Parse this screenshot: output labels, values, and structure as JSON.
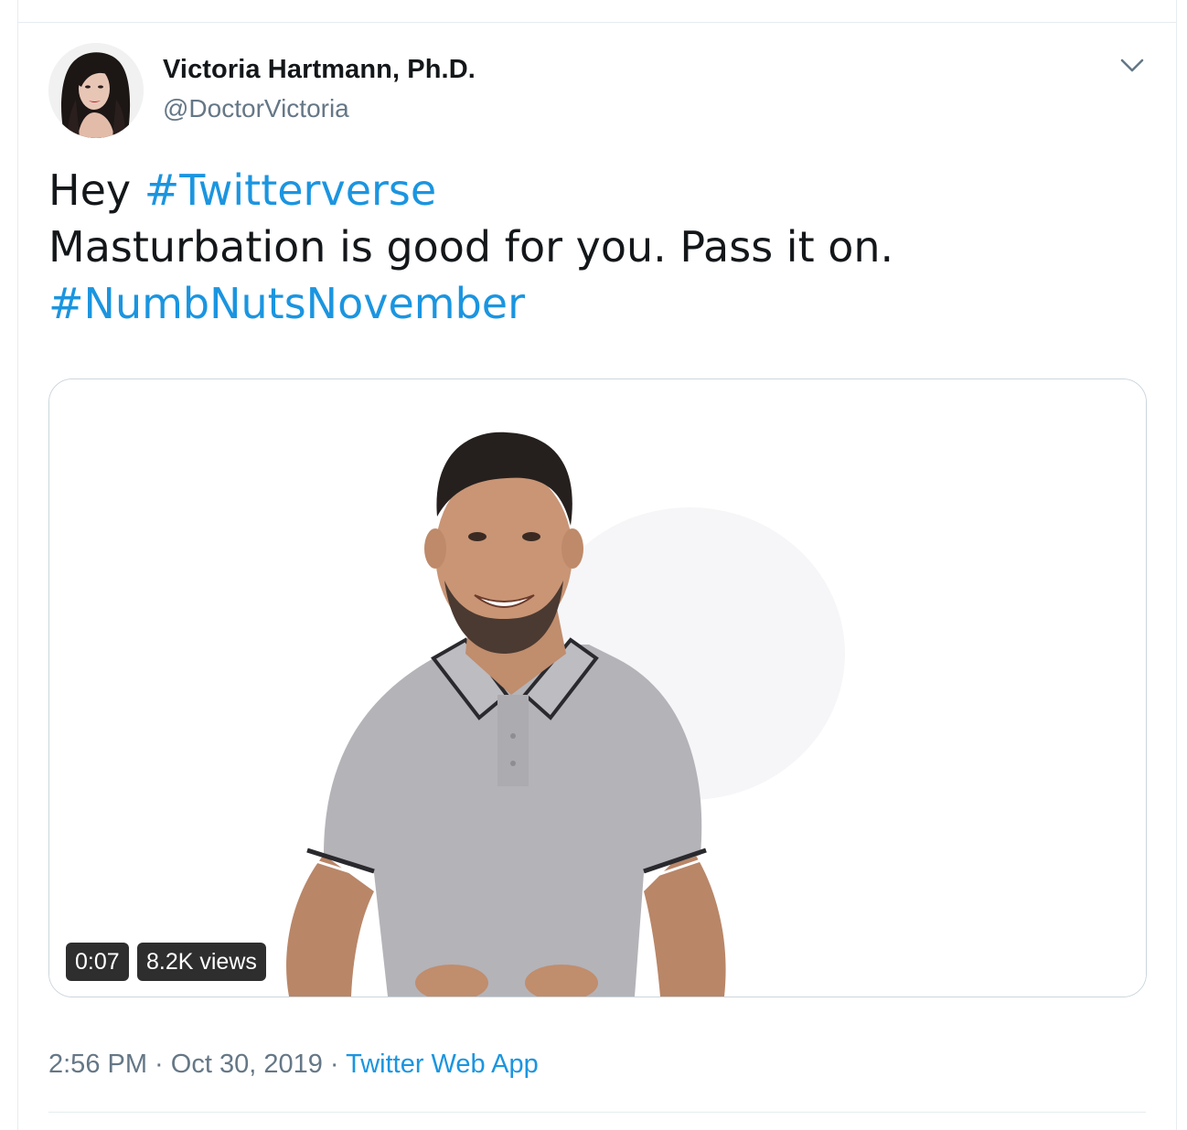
{
  "tweet": {
    "author": {
      "display_name": "Victoria Hartmann, Ph.D.",
      "handle": "@DoctorVictoria",
      "avatar_icon": "profile-photo"
    },
    "text": {
      "line1_prefix": "Hey ",
      "line1_hashtag": "#Twitterverse",
      "line2": "Masturbation is good for you. Pass it on.",
      "line3_hashtag": "#NumbNutsNovember"
    },
    "video": {
      "duration": "0:07",
      "views": "8.2K views"
    },
    "meta": {
      "time": "2:56 PM",
      "separator": " · ",
      "date": "Oct 30, 2019",
      "source": "Twitter Web App"
    }
  },
  "colors": {
    "link": "#1b95e0",
    "text": "#14171a",
    "secondary": "#657786",
    "border": "#ccd6dd"
  },
  "icons": {
    "menu": "chevron-down-icon"
  }
}
